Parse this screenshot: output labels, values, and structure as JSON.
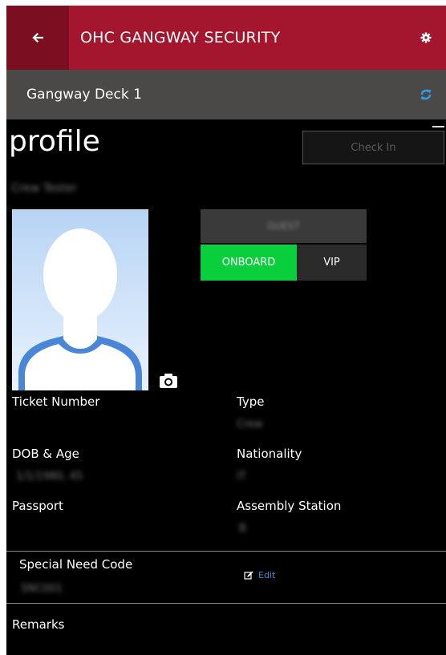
{
  "header": {
    "title": "OHC GANGWAY SECURITY",
    "back_icon": "back-arrow-icon",
    "settings_icon": "gear-icon",
    "background_color": "#a4162d"
  },
  "subheader": {
    "location": "Gangway Deck 1",
    "refresh_icon": "refresh-icon",
    "refresh_color": "#2f9be0"
  },
  "page": {
    "title": "profile",
    "check_in_label": "Check In",
    "name": "Crew Tester"
  },
  "status": {
    "top_label": "GUEST",
    "onboard_label": "ONBOARD",
    "vip_label": "VIP",
    "onboard_color": "#09cf3c"
  },
  "fields": {
    "ticket_number": {
      "label": "Ticket Number",
      "value": ""
    },
    "type": {
      "label": "Type",
      "value": "Crew"
    },
    "dob_age": {
      "label": "DOB & Age",
      "value": "1/1/1980, 45"
    },
    "nationality": {
      "label": "Nationality",
      "value": "IT"
    },
    "passport": {
      "label": "Passport",
      "value": ""
    },
    "assembly_station": {
      "label": "Assembly Station",
      "value": "B"
    },
    "special_need_code": {
      "label": "Special Need Code",
      "value": "SNC001"
    },
    "remarks": {
      "label": "Remarks",
      "value": ""
    }
  },
  "actions": {
    "edit_label": "Edit",
    "edit_icon": "edit-icon",
    "camera_icon": "camera-icon"
  }
}
